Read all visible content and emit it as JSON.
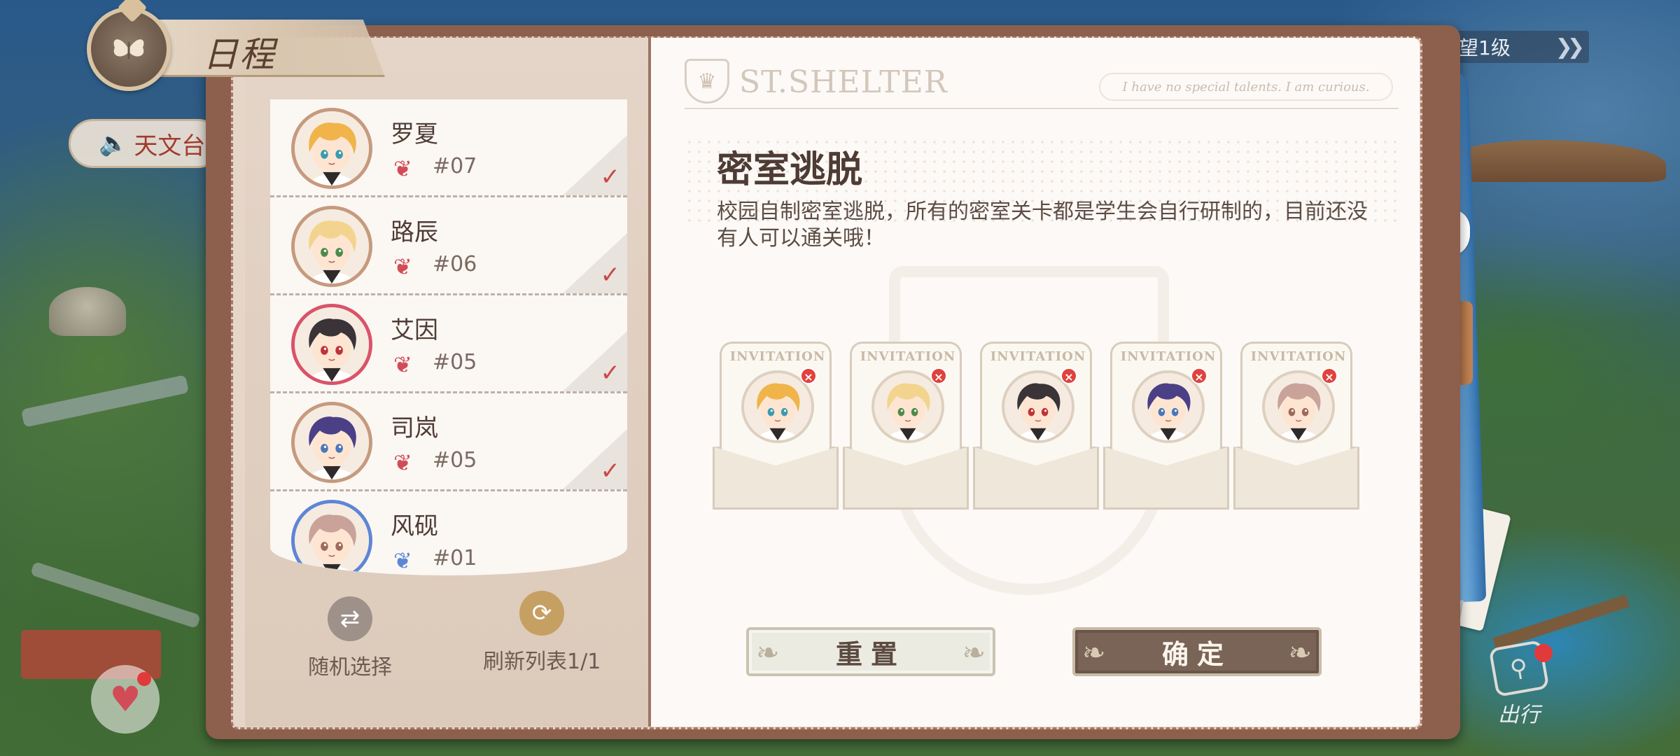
{
  "title": "日程",
  "tianwen_button": "天文台",
  "level_tag": "望1级",
  "travel_label": "出行",
  "brand": {
    "title": "ST.SHELTER",
    "quote": "I have no special talents. I am curious."
  },
  "characters": [
    {
      "name": "罗夏",
      "num": "#07",
      "selected": true,
      "hair": "#f0b44a",
      "eyes": "#3a9bb0",
      "ring": "#c69a7e",
      "heart_color": "#d24c58"
    },
    {
      "name": "路辰",
      "num": "#06",
      "selected": true,
      "hair": "#f3d48e",
      "eyes": "#4f8a4a",
      "ring": "#c69a7e",
      "heart_color": "#d24c58"
    },
    {
      "name": "艾因",
      "num": "#05",
      "selected": true,
      "hair": "#3a3438",
      "eyes": "#c0323a",
      "ring": "#d9536a",
      "heart_color": "#d24c58"
    },
    {
      "name": "司岚",
      "num": "#05",
      "selected": true,
      "hair": "#4b3f86",
      "eyes": "#4a78b8",
      "ring": "#c69a7e",
      "heart_color": "#d24c58"
    },
    {
      "name": "风砚",
      "num": "#01",
      "selected": false,
      "hair": "#c9a29a",
      "eyes": "#a06a5a",
      "ring": "#5d86d6",
      "heart_color": "#5d86d6"
    }
  ],
  "controls": {
    "random_label": "随机选择",
    "refresh_label": "刷新列表1/1"
  },
  "event": {
    "title": "密室逃脱",
    "description": "校园自制密室逃脱，所有的密室关卡都是学生会自行研制的，目前还没有人可以通关哦！"
  },
  "invitation_label": "INVITATION",
  "invitations": [
    {
      "hair": "#f0b44a",
      "eyes": "#3a9bb0"
    },
    {
      "hair": "#f3d48e",
      "eyes": "#4f8a4a"
    },
    {
      "hair": "#3a3438",
      "eyes": "#c0323a"
    },
    {
      "hair": "#4b3f86",
      "eyes": "#4a78b8"
    },
    {
      "hair": "#c9a29a",
      "eyes": "#a06a5a"
    }
  ],
  "buttons": {
    "reset": "重置",
    "confirm": "确定"
  },
  "colors": {
    "accent_red": "#c84a45",
    "confirm_bg": "#7a6357",
    "frame": "#8d5f4d"
  }
}
